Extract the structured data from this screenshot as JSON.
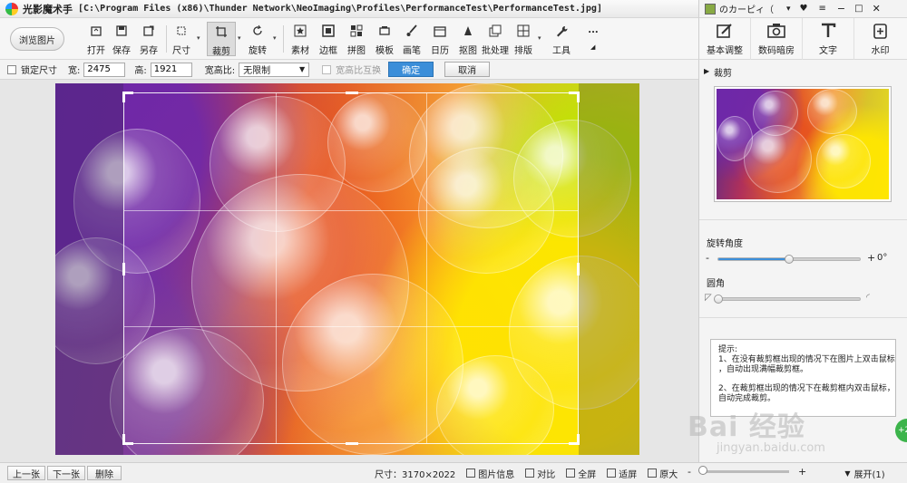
{
  "window": {
    "app_name": "光影魔术手",
    "path": "[C:\\Program Files (x86)\\Thunder Network\\NeoImaging\\Profiles\\PerformanceTest\\PerformanceTest.jpg]",
    "user_name": "のカーピィ（"
  },
  "toolbar": {
    "browse": "浏览图片",
    "open": "打开",
    "save": "保存",
    "save_as": "另存",
    "size": "尺寸",
    "crop": "裁剪",
    "rotate": "旋转",
    "material": "素材",
    "border": "边框",
    "collage": "拼图",
    "template": "模板",
    "brush": "画笔",
    "calendar": "日历",
    "cutout": "抠图",
    "batch": "批处理",
    "layout": "排版",
    "tools": "工具",
    "more": "..."
  },
  "options": {
    "lock_size": "锁定尺寸",
    "width_label": "宽:",
    "width_value": "2475",
    "height_label": "高:",
    "height_value": "1921",
    "ratio_label": "宽高比:",
    "ratio_value": "无限制",
    "swap_label": "宽高比互换",
    "confirm": "确定",
    "cancel": "取消"
  },
  "right_tabs": {
    "basic": "基本调整",
    "darkroom": "数码暗房",
    "text": "文字",
    "watermark": "水印"
  },
  "panel": {
    "section": "裁剪",
    "rotate_label": "旋转角度",
    "rotate_minus": "-",
    "rotate_plus": "+",
    "rotate_value": "0°",
    "rotate_fraction": 0.5,
    "round_label": "圆角",
    "round_fraction": 0.0,
    "tip_title": "提示:",
    "tip_1a": "1、在没有裁剪框出现的情况下在图片上双击鼠标",
    "tip_1b": "，自动出现满幅裁剪框。",
    "tip_2a": "2、在裁剪框出现的情况下在裁剪框内双击鼠标，",
    "tip_2b": "自动完成裁剪。"
  },
  "status": {
    "prev": "上一张",
    "next": "下一张",
    "delete": "删除",
    "size_text": "尺寸：3170×2022",
    "info": "图片信息",
    "compare": "对比",
    "fullscreen": "全屏",
    "fit": "适屏",
    "original": "原大",
    "zoom_minus": "-",
    "zoom_plus": "+",
    "expand": "展开(1)"
  },
  "overlay": {
    "watermark": "Bai 经验",
    "watermark_sub": "jingyan.baidu.com",
    "badge": "+2"
  },
  "colors": {
    "accent": "#3b8ed9"
  }
}
